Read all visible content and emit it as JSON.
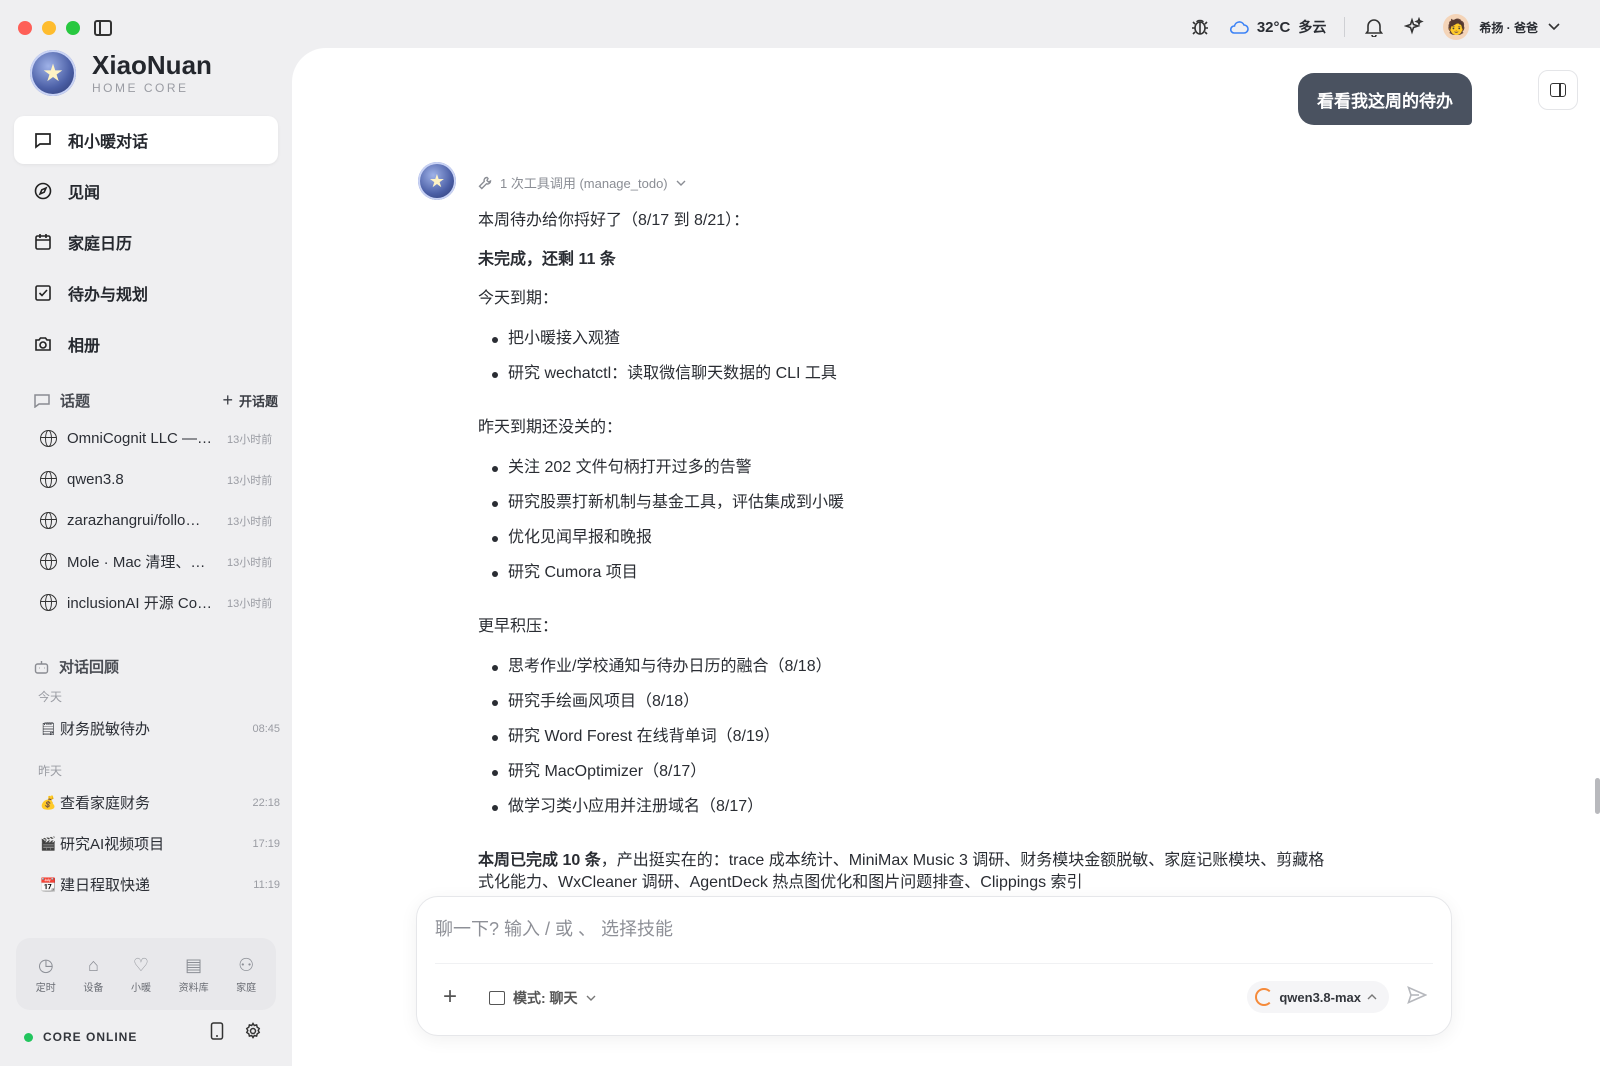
{
  "window": {
    "traffic": [
      "close",
      "minimize",
      "zoom"
    ]
  },
  "topbar": {
    "weather_temp": "32°C",
    "weather_cond": "多云",
    "user_name": "希扬 · 爸爸",
    "icons": [
      "bug-icon",
      "cloud-icon",
      "bell-icon",
      "sparkles-icon",
      "chevron-down-icon"
    ]
  },
  "brand": {
    "title": "XiaoNuan",
    "subtitle": "HOME CORE"
  },
  "nav": {
    "items": [
      {
        "label": "和小暖对话",
        "icon": "chat-icon",
        "active": true
      },
      {
        "label": "见闻",
        "icon": "compass-icon"
      },
      {
        "label": "家庭日历",
        "icon": "calendar-icon"
      },
      {
        "label": "待办与规划",
        "icon": "checkbox-icon"
      },
      {
        "label": "相册",
        "icon": "camera-icon"
      }
    ]
  },
  "topics": {
    "header": "话题",
    "new_label": "开话题",
    "items": [
      {
        "title": "OmniCognit LLC —…",
        "time": "13小时前"
      },
      {
        "title": "qwen3.8",
        "time": "13小时前"
      },
      {
        "title": "zarazhangrui/follo…",
        "time": "13小时前"
      },
      {
        "title": "Mole · Mac 清理、…",
        "time": "13小时前"
      },
      {
        "title": "inclusionAI 开源 Co…",
        "time": "13小时前"
      }
    ]
  },
  "recap": {
    "header": "对话回顾",
    "groups": [
      {
        "label": "今天",
        "items": [
          {
            "emoji": "🗒",
            "title": "财务脱敏待办",
            "time": "08:45"
          }
        ]
      },
      {
        "label": "昨天",
        "items": [
          {
            "emoji": "💰",
            "title": "查看家庭财务",
            "time": "22:18"
          },
          {
            "emoji": "🎬",
            "title": "研究AI视频项目",
            "time": "17:19"
          },
          {
            "emoji": "📆",
            "title": "建日程取快递",
            "time": "11:19"
          }
        ]
      }
    ]
  },
  "dock": {
    "items": [
      {
        "label": "定时",
        "glyph": "◷",
        "icon": "clock-icon"
      },
      {
        "label": "设备",
        "glyph": "⌂",
        "icon": "router-icon"
      },
      {
        "label": "小暖",
        "glyph": "♡",
        "icon": "heart-icon"
      },
      {
        "label": "资料库",
        "glyph": "▤",
        "icon": "archive-icon"
      },
      {
        "label": "家庭",
        "glyph": "⚇",
        "icon": "users-icon"
      }
    ]
  },
  "status": {
    "label": "CORE ONLINE"
  },
  "chat": {
    "user_message": "看看我这周的待办",
    "tool_call": "1 次工具调用 (manage_todo)",
    "intro": "本周待办给你捋好了（8/17 到 8/21）：",
    "summary": "未完成，还剩 11 条",
    "sections": [
      {
        "title": "今天到期：",
        "items": [
          "把小暖接入观猹",
          "研究 wechatctl：读取微信聊天数据的 CLI 工具"
        ]
      },
      {
        "title": "昨天到期还没关的：",
        "items": [
          "关注 202 文件句柄打开过多的告警",
          "研究股票打新机制与基金工具，评估集成到小暖",
          "优化见闻早报和晚报",
          "研究 Cumora 项目"
        ]
      },
      {
        "title": "更早积压：",
        "items": [
          "思考作业/学校通知与待办日历的融合（8/18）",
          "研究手绘画风项目（8/18）",
          "研究 Word Forest 在线背单词（8/19）",
          "研究 MacOptimizer（8/17）",
          "做学习类小应用并注册域名（8/17）"
        ]
      }
    ],
    "done_bold": "本周已完成 10 条",
    "done_rest": "，产出挺实在的：trace 成本统计、MiniMax Music 3 调研、财务模块金额脱敏、家庭记账模块、剪藏格式化能力、WxCleaner 调研、AgentDeck 热点图优化和图片问题排查、Clippings 索引"
  },
  "composer": {
    "placeholder": "聊一下? 输入 / 或 、 选择技能",
    "mode_label": "模式: 聊天",
    "model_label": "qwen3.8-max"
  }
}
